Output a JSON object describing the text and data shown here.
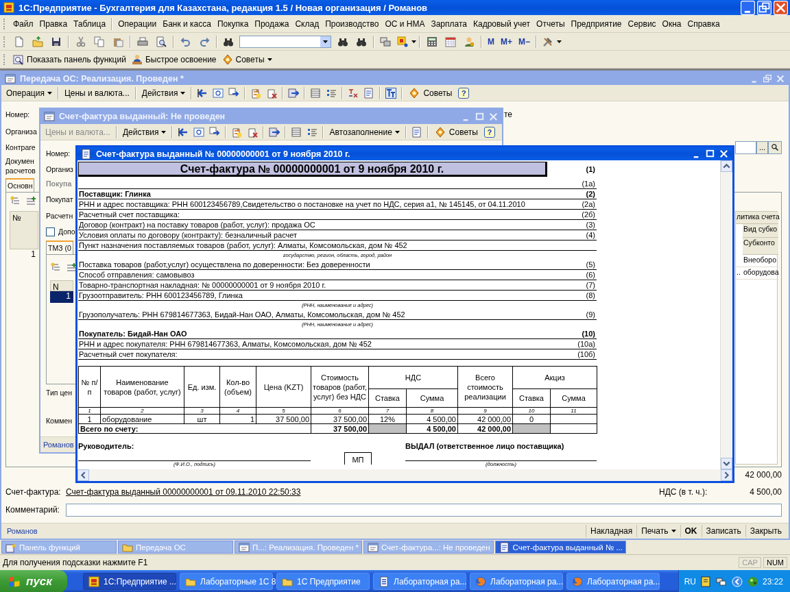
{
  "app": {
    "title": "1С:Предприятие - Бухгалтерия для Казахстана, редакция 1.5 / Новая организация / Романов",
    "menu": [
      "Файл",
      "Правка",
      "Таблица",
      "Операции",
      "Банк и касса",
      "Покупка",
      "Продажа",
      "Склад",
      "Производство",
      "ОС и НМА",
      "Зарплата",
      "Кадровый учет",
      "Отчеты",
      "Предприятие",
      "Сервис",
      "Окна",
      "Справка"
    ],
    "memory_buttons": [
      "M",
      "M+",
      "M−"
    ],
    "quick_bar": [
      "Показать панель функций",
      "Быстрое освоение",
      "Советы"
    ]
  },
  "transfer_window": {
    "title": "Передача ОС: Реализация. Проведен *",
    "active": false,
    "toolbar": {
      "before": [
        {
          "label": "Операция",
          "kind": "dropdown",
          "disabled": false
        },
        {
          "label": "Цены и валюта...",
          "kind": "button",
          "disabled": false
        },
        {
          "label": "Действия",
          "kind": "dropdown",
          "disabled": false
        }
      ],
      "tips": "Советы",
      "help": "?"
    },
    "number_label": "Номер:",
    "side_text": "те",
    "org_label": "Организа",
    "contractor_label": "Контраге",
    "contractor_button": "...",
    "doc_label_lines": [
      "Докумен",
      "расчетов"
    ],
    "tabs": [
      {
        "label": "Основн",
        "selected": true
      }
    ],
    "table_header": "№",
    "row_number": "1",
    "account_table": {
      "header": "литика счета",
      "subheaders": [
        "Вид субко",
        "Субконто"
      ],
      "rows": [
        {
          "value": "Внеоборо"
        },
        {
          "marker": "..",
          "value": "оборудова"
        }
      ]
    },
    "total": "42 000,00",
    "invoice_label": "Счет-фактура:",
    "invoice_link": "Счет-фактура выданный 00000000001 от 09.11.2010 22:50:33",
    "vat_label": "НДС (в т. ч.):",
    "vat": "4 500,00",
    "comment_label": "Комментарий:",
    "footer": {
      "author": "Романов",
      "buttons": [
        {
          "label": "Накладная",
          "kind": "button"
        },
        {
          "label": "Печать",
          "kind": "dropdown"
        },
        {
          "label": "OK",
          "kind": "default"
        },
        {
          "label": "Записать",
          "kind": "button"
        },
        {
          "label": "Закрыть",
          "kind": "button"
        }
      ]
    }
  },
  "invoice_window": {
    "title": "Счет-фактура выданный: Не проведен",
    "active": false,
    "toolbar": {
      "before": [
        {
          "label": "Цены и валюта...",
          "kind": "button",
          "disabled": true
        },
        {
          "label": "Действия",
          "kind": "dropdown",
          "disabled": false
        }
      ],
      "after": [
        {
          "label": "Автозаполнение",
          "kind": "dropdown",
          "disabled": false
        }
      ],
      "tips": "Советы",
      "help": "?"
    },
    "labels": [
      "Номер:",
      "Организ"
    ],
    "section": "Покупа",
    "labels2": [
      "Покупат",
      "Расчетн"
    ],
    "checkbox": {
      "label": "Допо",
      "checked": false
    },
    "tabs": [
      {
        "label": "ТМЗ (0",
        "selected": true
      }
    ],
    "table_header": "N",
    "rows": [
      {
        "number": "1",
        "selected": true
      }
    ],
    "price_label": "Тип цен",
    "comment_label": "Коммен",
    "author": "Романов"
  },
  "print_window": {
    "title": "Счет-фактура выданный № 00000000001 от 9 ноября 2010 г.",
    "active": true,
    "document": {
      "title": "Счет-фактура № 00000000001 от 9 ноября 2010 г.",
      "title_ref": "(1)",
      "lines": [
        {
          "kind": "ref",
          "ref": "(1а)"
        },
        {
          "kind": "bold",
          "text": "Поставщик:  Глинка",
          "ref": "(2)"
        },
        {
          "kind": "line",
          "text": "РНН и адрес поставщика:  РНН 600123456789,Свидетельство о постановке на учет по НДС,  серия а1,  № 145145, от 04.11.2010",
          "ref": "(2а)"
        },
        {
          "kind": "line",
          "text": "Расчетный счет поставщика:",
          "ref": "(2б)"
        },
        {
          "kind": "line",
          "text": "Договор (контракт) на поставку товаров (работ, услуг): продажа ОС",
          "ref": "(3)"
        },
        {
          "kind": "line",
          "text": "Условия оплаты по договору (контракту): безналичный расчет",
          "ref": "(4)"
        },
        {
          "kind": "line",
          "text": "Пункт назначения поставляемых товаров (работ, услуг):  Алматы, Комсомольская, дом № 452"
        },
        {
          "kind": "caption",
          "text": "государство, регион, область, город, район"
        },
        {
          "kind": "line",
          "text": "Поставка товаров (работ,услуг) осуществлена по доверенности:  Без доверенности",
          "ref": "(5)"
        },
        {
          "kind": "line",
          "text": "Способ отправления: самовывоз",
          "ref": "(6)"
        },
        {
          "kind": "line",
          "text": "Товарно-транспортная накладная:  № 00000000001 от 9 ноября 2010 г.",
          "ref": "(7)"
        },
        {
          "kind": "line",
          "text": "Грузоотправитель:  РНН 600123456789, Глинка",
          "ref": "(8)"
        },
        {
          "kind": "caption",
          "text": "(РНН, наименование и адрес)"
        },
        {
          "kind": "line",
          "text": "Грузополучатель:  РНН 679814677363, Бидай-Нан ОАО, Алматы, Комсомольская, дом № 452",
          "ref": "(9)"
        },
        {
          "kind": "caption",
          "text": "(РНН, наименование и адрес)"
        },
        {
          "kind": "bold",
          "text": "Покупатель:  Бидай-Нан ОАО",
          "ref": "(10)"
        },
        {
          "kind": "line",
          "text": "РНН и адрес покупателя:  РНН 679814677363, Алматы, Комсомольская, дом № 452",
          "ref": "(10а)"
        },
        {
          "kind": "line",
          "text": "Расчетный счет покупателя:",
          "ref": "(10б)"
        }
      ],
      "table": {
        "head": [
          {
            "label": "№ п/п"
          },
          {
            "label": "Наименование товаров (работ, услуг)"
          },
          {
            "label": "Ед. изм."
          },
          {
            "label": "Кол-во (объем)"
          },
          {
            "label": "Цена (KZT)"
          },
          {
            "label": "Стоимость товаров (работ, услуг) без НДС"
          },
          {
            "label": "НДС",
            "sub": [
              "Ставка",
              "Сумма"
            ]
          },
          {
            "label": "Всего стоимость реализации"
          },
          {
            "label": "Акциз",
            "sub": [
              "Ставка",
              "Сумма"
            ]
          }
        ],
        "numbers": [
          "1",
          "2",
          "3",
          "4",
          "5",
          "6",
          "7",
          "8",
          "9",
          "10",
          "11"
        ],
        "rows": [
          [
            "1",
            "оборудование",
            "шт",
            "1",
            "37 500,00",
            "37 500,00",
            "12%",
            "4 500,00",
            "42 000,00",
            "0"
          ]
        ],
        "total": {
          "label": "Всего по счету:",
          "cells": [
            {
              "kind": "value",
              "text": "37 500,00"
            },
            {
              "kind": "shaded"
            },
            {
              "kind": "value",
              "text": "4 500,00"
            },
            {
              "kind": "value",
              "text": "42 000,00"
            },
            {
              "kind": "shaded"
            },
            {
              "kind": "blank"
            }
          ]
        }
      },
      "signatures": [
        {
          "title": "Руководитель:",
          "caption": "(Ф.И.О., подпись)"
        },
        {
          "title": "ВЫДАЛ (ответственное лицо поставщика)",
          "caption": "(должность)"
        }
      ],
      "stamp": "МП"
    }
  },
  "window_bar": [
    {
      "label": "Панель функций",
      "kind": "panel",
      "selected": false
    },
    {
      "label": "Передача ОС",
      "kind": "folder",
      "selected": false
    },
    {
      "label": "П...: Реализация. Проведен *",
      "kind": "form",
      "selected": false
    },
    {
      "label": "Счет-фактура...: Не проведен",
      "kind": "form",
      "selected": false
    },
    {
      "label": "Счет-фактура выданный № ...",
      "kind": "report",
      "selected": true
    }
  ],
  "status_bar": {
    "hint": "Для получения подсказки нажмите F1",
    "indicators": [
      {
        "label": "CAP",
        "on": false
      },
      {
        "label": "NUM",
        "on": true
      }
    ]
  },
  "taskbar": {
    "start": "пуск",
    "items": [
      {
        "label": "1С:Предприятие ...",
        "kind": "app",
        "selected": true
      },
      {
        "label": "Лабораторные 1С 8",
        "kind": "folder",
        "selected": false
      },
      {
        "label": "1С Предприятие",
        "kind": "folder",
        "selected": false
      },
      {
        "label": "Лабораторная ра...",
        "kind": "document",
        "selected": false
      },
      {
        "label": "Лабораторная ра...",
        "kind": "browser",
        "selected": false
      },
      {
        "label": "Лабораторная ра...",
        "kind": "browser",
        "selected": false
      }
    ],
    "language": "RU",
    "clock": "23:22"
  }
}
